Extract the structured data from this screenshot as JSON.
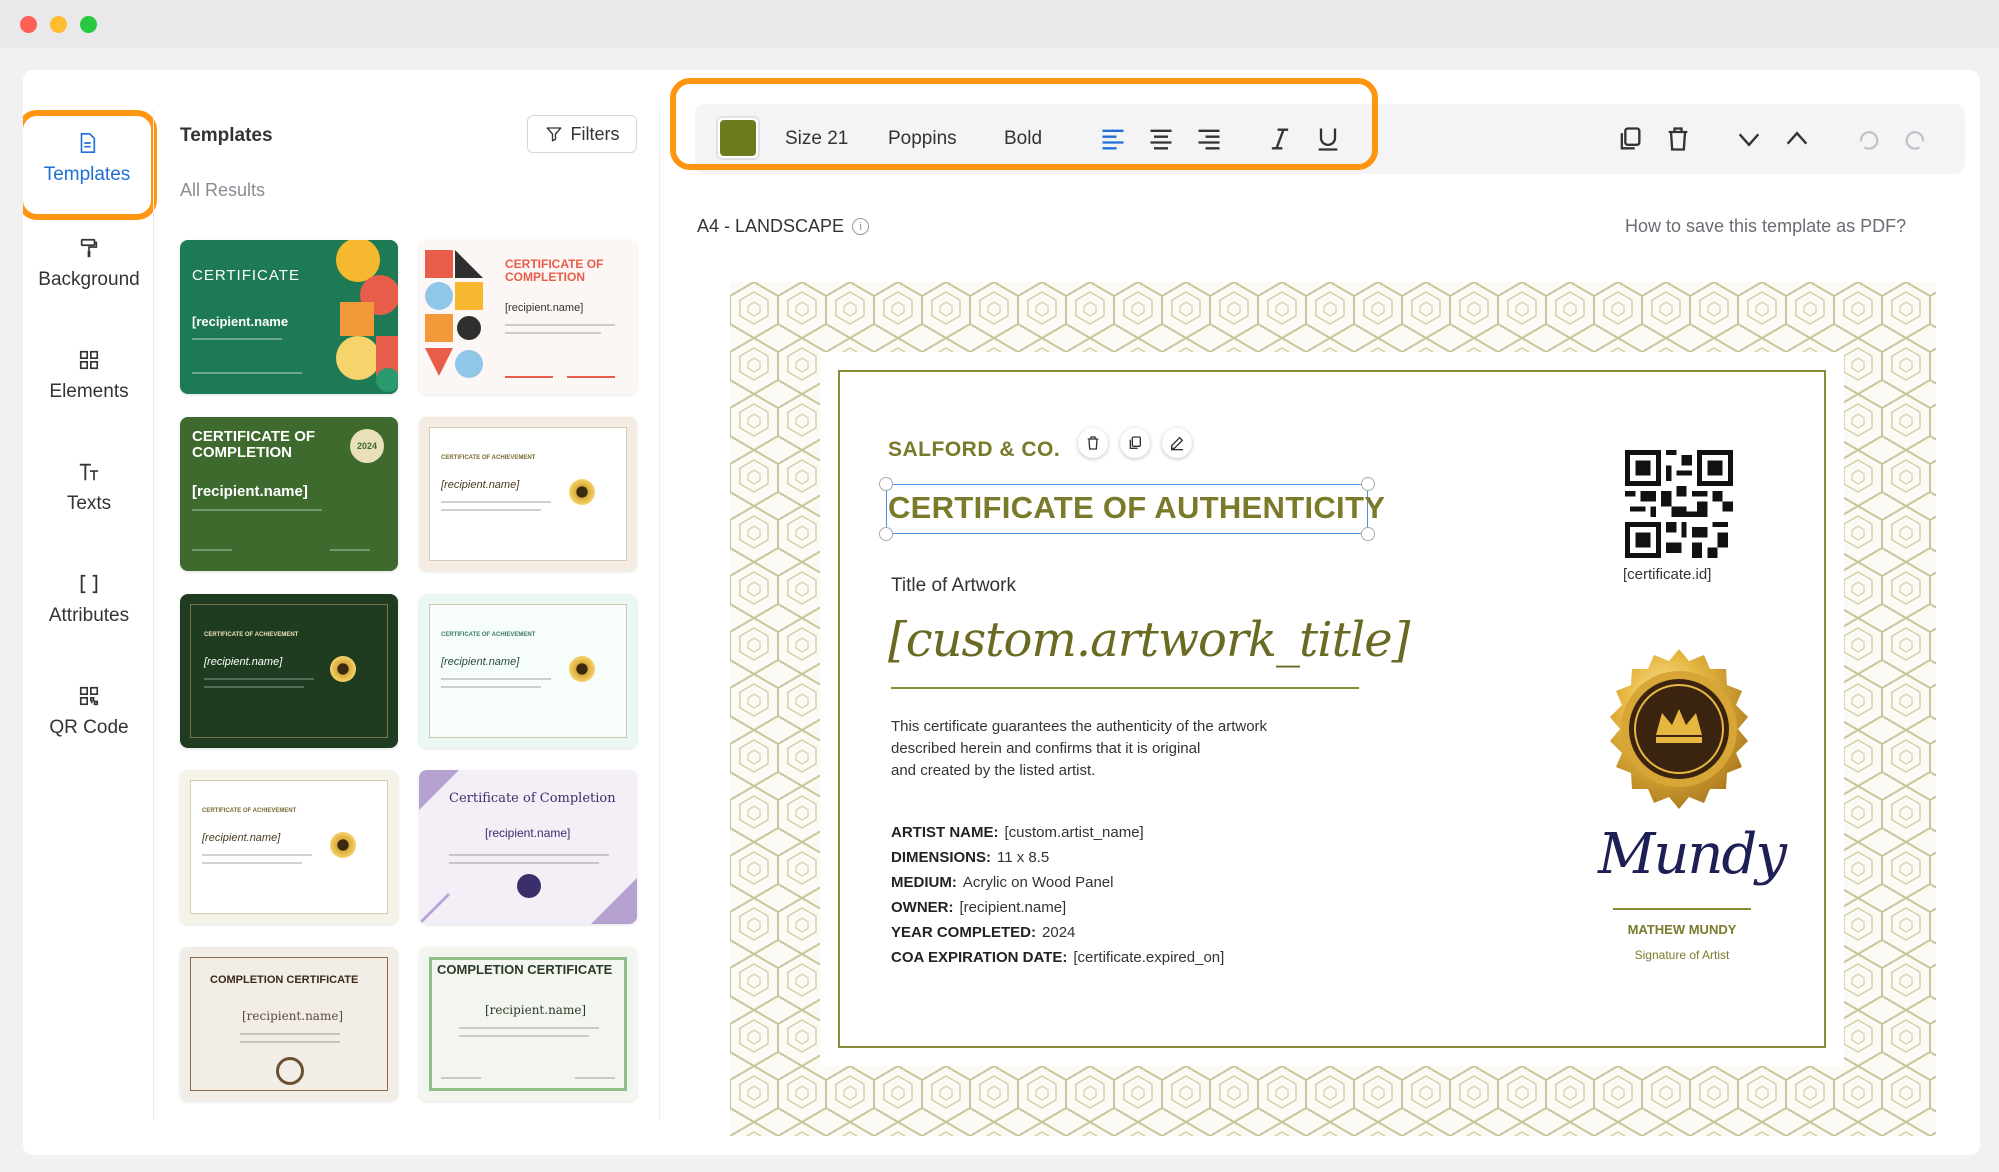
{
  "window": {
    "controls": [
      "close",
      "minimize",
      "zoom"
    ]
  },
  "nav": {
    "items": [
      {
        "label": "Templates",
        "icon": "file-icon",
        "active": true
      },
      {
        "label": "Background",
        "icon": "paint-roller-icon",
        "active": false
      },
      {
        "label": "Elements",
        "icon": "grid-icon",
        "active": false
      },
      {
        "label": "Texts",
        "icon": "text-icon",
        "active": false
      },
      {
        "label": "Attributes",
        "icon": "brackets-icon",
        "active": false
      },
      {
        "label": "QR Code",
        "icon": "qr-code-icon",
        "active": false
      }
    ]
  },
  "panel": {
    "title": "Templates",
    "filters_label": "Filters",
    "all_results": "All Results",
    "templates": [
      {
        "title": "CERTIFICATE",
        "name": "[recipient.name"
      },
      {
        "title": "CERTIFICATE OF COMPLETION",
        "name": "[recipient.name]"
      },
      {
        "title": "CERTIFICATE OF COMPLETION",
        "name": "[recipient.name]",
        "badge": "2024"
      },
      {
        "title": "CERTIFICATE OF ACHIEVEMENT",
        "name": "[recipient.name]"
      },
      {
        "title": "CERTIFICATE OF ACHIEVEMENT",
        "name": "[recipient.name]"
      },
      {
        "title": "CERTIFICATE OF ACHIEVEMENT",
        "name": "[recipient.name]"
      },
      {
        "title": "CERTIFICATE OF ACHIEVEMENT",
        "name": "[recipient.name]"
      },
      {
        "title": "Certificate of Completion",
        "name": "[recipient.name]"
      },
      {
        "title": "COMPLETION CERTIFICATE",
        "name": "[recipient.name]"
      },
      {
        "title": "COMPLETION CERTIFICATE",
        "name": "[recipient.name]"
      }
    ]
  },
  "toolbar": {
    "color": "#6e7a1e",
    "size_label": "Size 21",
    "font_label": "Poppins",
    "weight_label": "Bold",
    "highlight_color": "#ff9510"
  },
  "canvas": {
    "page_size": "A4 - LANDSCAPE",
    "help_link": "How to save this template as PDF?"
  },
  "certificate": {
    "company": "SALFORD & CO.",
    "title": "CERTIFICATE OF AUTHENTICITY",
    "artwork_label": "Title of Artwork",
    "artwork_value": "[custom.artwork_title]",
    "description": "This certificate guarantees the authenticity of the artwork described herein and confirms that it is original and created by the listed artist.",
    "desc_line1": "This certificate guarantees the authenticity of the artwork",
    "desc_line2": "described herein and confirms that it is original",
    "desc_line3": "and created by the listed artist.",
    "fields": [
      {
        "label": "ARTIST NAME:",
        "value": "[custom.artist_name]"
      },
      {
        "label": "DIMENSIONS:",
        "value": "11 x 8.5"
      },
      {
        "label": "MEDIUM:",
        "value": "Acrylic on Wood Panel"
      },
      {
        "label": "OWNER:",
        "value": "[recipient.name]"
      },
      {
        "label": "YEAR COMPLETED:",
        "value": "2024"
      },
      {
        "label": "COA EXPIRATION DATE:",
        "value": "[certificate.expired_on]"
      }
    ],
    "qr_label": "[certificate.id]",
    "signature": "Mundy",
    "signer_name": "MATHEW MUNDY",
    "signer_title": "Signature of Artist",
    "accent_color": "#7a7a2a"
  }
}
